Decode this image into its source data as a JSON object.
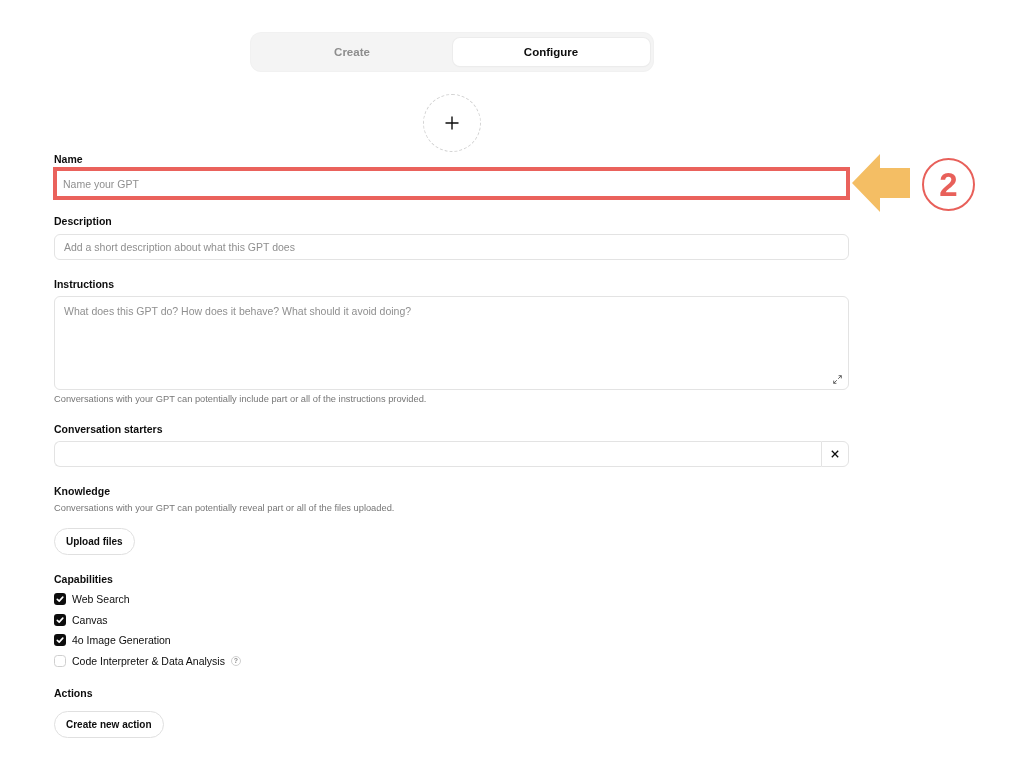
{
  "tabs": [
    {
      "label": "Create",
      "selected": false
    },
    {
      "label": "Configure",
      "selected": true
    }
  ],
  "sections": [
    {
      "kind": "input",
      "label": "Name",
      "placeholder": "Name your GPT",
      "highlighted": true
    },
    {
      "kind": "input",
      "label": "Description",
      "placeholder": "Add a short description about what this GPT does",
      "highlighted": false
    },
    {
      "kind": "textarea",
      "label": "Instructions",
      "placeholder": "What does this GPT do? How does it behave? What should it avoid doing?",
      "hint": "Conversations with your GPT can potentially include part or all of the instructions provided.",
      "highlighted": false
    },
    {
      "kind": "starter",
      "label": "Conversation starters",
      "highlighted": false
    },
    {
      "kind": "upload",
      "label": "Knowledge",
      "hint": "Conversations with your GPT can potentially reveal part or all of the files uploaded.",
      "button": "Upload files"
    },
    {
      "kind": "checklist",
      "label": "Capabilities",
      "items": [
        {
          "label": "Web Search",
          "checked": true
        },
        {
          "label": "Canvas",
          "checked": true
        },
        {
          "label": "4o Image Generation",
          "checked": true
        },
        {
          "label": "Code Interpreter & Data Analysis",
          "checked": false,
          "info": "?"
        }
      ]
    },
    {
      "kind": "button",
      "label": "Actions",
      "button": "Create new action"
    }
  ],
  "annotation": {
    "step": "2"
  }
}
